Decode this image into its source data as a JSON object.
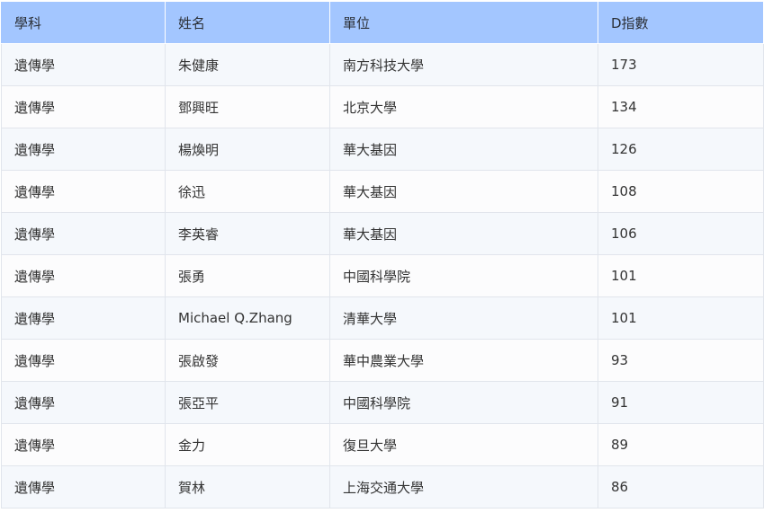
{
  "table": {
    "headers": [
      "學科",
      "姓名",
      "單位",
      "D指數"
    ],
    "rows": [
      [
        "遺傳學",
        "朱健康",
        "南方科技大學",
        "173"
      ],
      [
        "遺傳學",
        "鄧興旺",
        "北京大學",
        "134"
      ],
      [
        "遺傳學",
        "楊煥明",
        "華大基因",
        "126"
      ],
      [
        "遺傳學",
        "徐迅",
        "華大基因",
        "108"
      ],
      [
        "遺傳學",
        "李英睿",
        "華大基因",
        "106"
      ],
      [
        "遺傳學",
        "張勇",
        "中國科學院",
        "101"
      ],
      [
        "遺傳學",
        "Michael Q.Zhang",
        "清華大學",
        "101"
      ],
      [
        "遺傳學",
        "張啟發",
        "華中農業大學",
        "93"
      ],
      [
        "遺傳學",
        "張亞平",
        "中國科學院",
        "91"
      ],
      [
        "遺傳學",
        "金力",
        "復旦大學",
        "89"
      ],
      [
        "遺傳學",
        "賀林",
        "上海交通大學",
        "86"
      ]
    ]
  },
  "colors": {
    "header_bg": "#a3c6ff",
    "row_odd_bg": "#f5f8fc",
    "row_even_bg": "#fcfcfd",
    "border": "#e1e5ec"
  }
}
